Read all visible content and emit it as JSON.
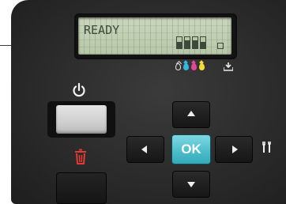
{
  "lcd": {
    "status_text": "READY",
    "ink_levels": [
      {
        "name": "black",
        "level": 0.6
      },
      {
        "name": "cyan",
        "level": 0.75
      },
      {
        "name": "magenta",
        "level": 0.75
      },
      {
        "name": "yellow",
        "level": 0.6
      }
    ]
  },
  "ink_indicators": {
    "icons": [
      "black-ink-drop-icon",
      "cyan-ink-drop-icon",
      "magenta-ink-drop-icon",
      "yellow-ink-drop-icon"
    ],
    "colors": [
      "#e8e8e8",
      "#35b6e0",
      "#e2479a",
      "#f3dc36"
    ]
  },
  "buttons": {
    "power": {
      "icon": "power-icon"
    },
    "cancel": {
      "icon": "trash-icon",
      "icon_color": "#e53935"
    },
    "ok": {
      "label": "OK",
      "color": "#49bccb"
    },
    "up": {
      "icon": "arrow-up-icon"
    },
    "down": {
      "icon": "arrow-down-icon"
    },
    "left": {
      "icon": "arrow-left-icon"
    },
    "right": {
      "icon": "arrow-right-icon"
    },
    "setup": {
      "icon": "setup-tools-icon"
    }
  }
}
